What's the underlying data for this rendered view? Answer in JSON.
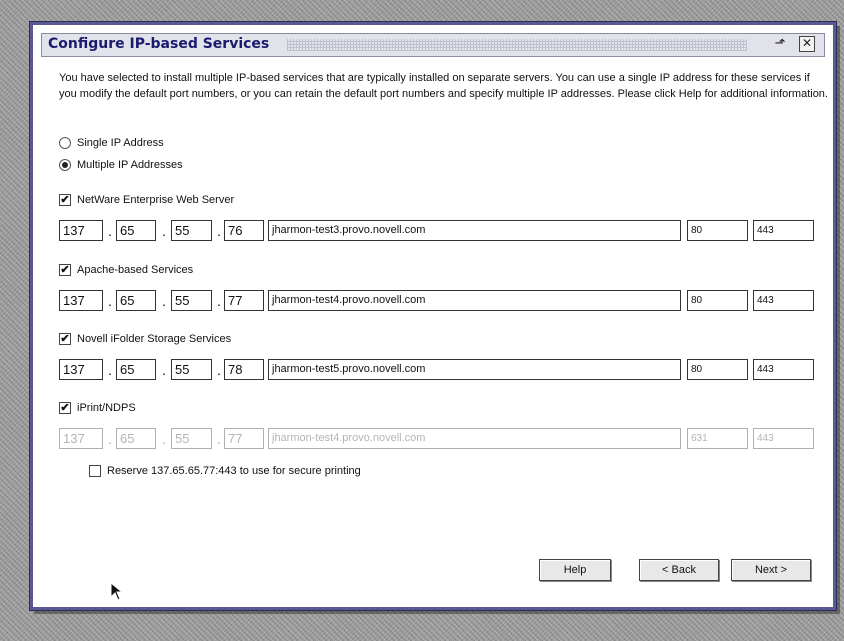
{
  "window": {
    "title": "Configure IP-based Services",
    "maximize_icon": "maximize-icon",
    "close_icon": "close-icon",
    "close_glyph": "✕",
    "maximize_glyph": "⬏"
  },
  "description": "You have selected to install multiple IP-based services that are typically installed on separate servers. You can use a single IP address for these services if you modify the default port numbers, or you can retain the default port numbers and specify multiple IP addresses. Please click Help for additional information.",
  "ip_mode": {
    "options": [
      {
        "label": "Single IP Address",
        "selected": false
      },
      {
        "label": "Multiple IP Addresses",
        "selected": true
      }
    ]
  },
  "services": [
    {
      "label": "NetWare Enterprise Web Server",
      "checked": true,
      "enabled": true,
      "ip": [
        "137",
        "65",
        "55",
        "76"
      ],
      "hostname": "jharmon-test3.provo.novell.com",
      "port1": "80",
      "port2": "443"
    },
    {
      "label": "Apache-based Services",
      "checked": true,
      "enabled": true,
      "ip": [
        "137",
        "65",
        "55",
        "77"
      ],
      "hostname": "jharmon-test4.provo.novell.com",
      "port1": "80",
      "port2": "443"
    },
    {
      "label": "Novell iFolder Storage Services",
      "checked": true,
      "enabled": true,
      "ip": [
        "137",
        "65",
        "55",
        "78"
      ],
      "hostname": "jharmon-test5.provo.novell.com",
      "port1": "80",
      "port2": "443"
    },
    {
      "label": "iPrint/NDPS",
      "checked": true,
      "enabled": false,
      "ip": [
        "137",
        "65",
        "55",
        "77"
      ],
      "hostname": "jharmon-test4.provo.novell.com",
      "port1": "631",
      "port2": "443"
    }
  ],
  "reserve": {
    "label": "Reserve 137.65.65.77:443 to use for secure printing",
    "checked": false
  },
  "buttons": {
    "help": "Help",
    "back": "< Back",
    "next": "Next >"
  },
  "check_glyph": "✔"
}
